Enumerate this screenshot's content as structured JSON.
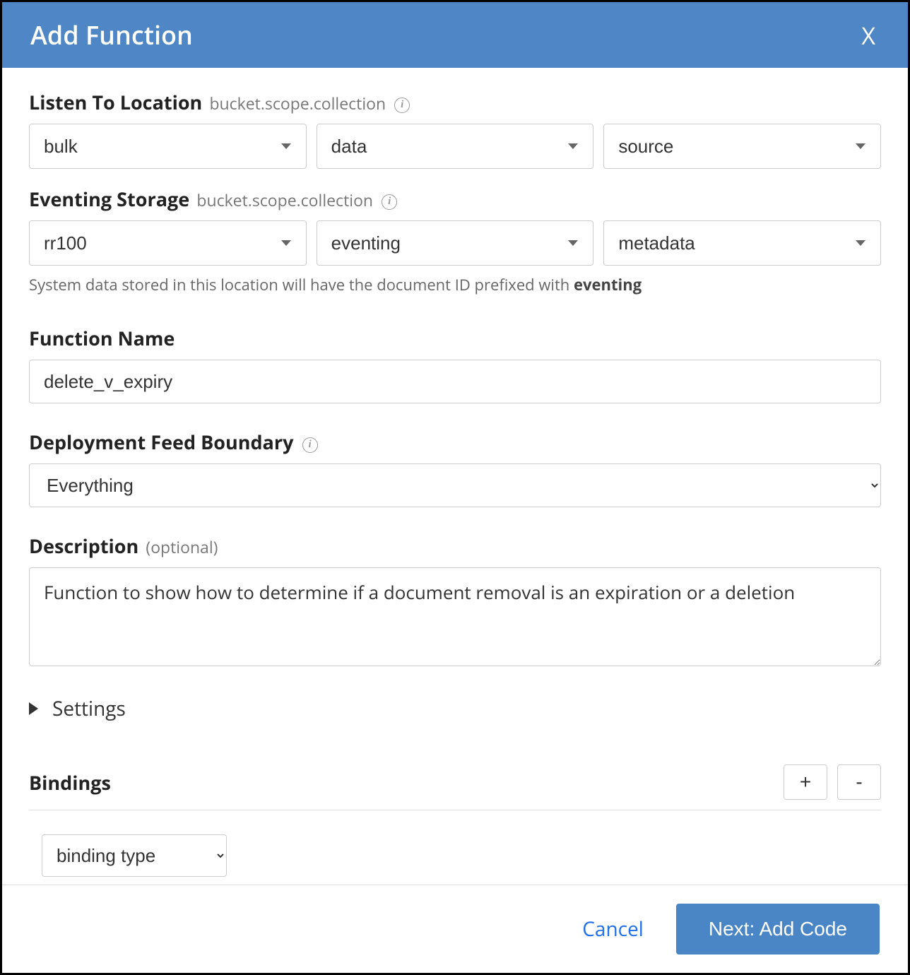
{
  "header": {
    "title": "Add Function",
    "close_glyph": "X"
  },
  "listen": {
    "label": "Listen To Location",
    "sublabel": "bucket.scope.collection",
    "bucket": "bulk",
    "scope": "data",
    "collection": "source"
  },
  "storage": {
    "label": "Eventing Storage",
    "sublabel": "bucket.scope.collection",
    "bucket": "rr100",
    "scope": "eventing",
    "collection": "metadata",
    "helper_prefix": "System data stored in this location will have the document ID prefixed with ",
    "helper_bold": "eventing"
  },
  "function_name": {
    "label": "Function Name",
    "value": "delete_v_expiry"
  },
  "deployment": {
    "label": "Deployment Feed Boundary",
    "value": "Everything"
  },
  "description": {
    "label": "Description",
    "optional": "(optional)",
    "value": "Function to show how to determine if a document removal is an expiration or a deletion"
  },
  "settings": {
    "label": "Settings"
  },
  "bindings": {
    "label": "Bindings",
    "add_glyph": "+",
    "remove_glyph": "-",
    "type_value": "binding type"
  },
  "footer": {
    "cancel": "Cancel",
    "next": "Next: Add Code"
  }
}
